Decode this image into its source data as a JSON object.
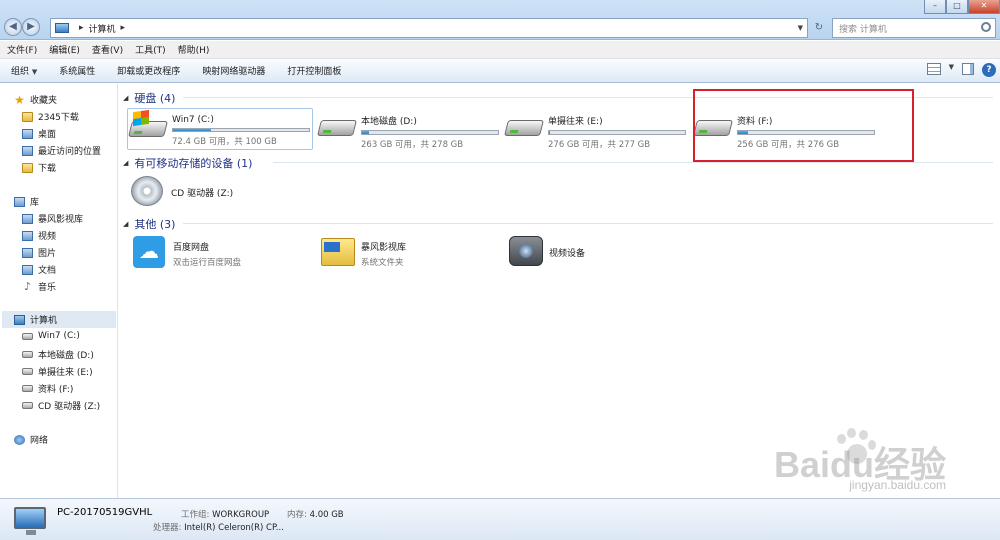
{
  "address": {
    "path": "计算机"
  },
  "search": {
    "placeholder": "搜索 计算机"
  },
  "menu": [
    "文件(F)",
    "编辑(E)",
    "查看(V)",
    "工具(T)",
    "帮助(H)"
  ],
  "commands": [
    "组织",
    "系统属性",
    "卸载或更改程序",
    "映射网络驱动器",
    "打开控制面板"
  ],
  "nav": {
    "favorites": {
      "label": "收藏夹",
      "items": [
        "2345下载",
        "桌面",
        "最近访问的位置",
        "下载"
      ]
    },
    "libraries": {
      "label": "库",
      "items": [
        "暴风影视库",
        "视频",
        "图片",
        "文档",
        "音乐"
      ]
    },
    "computer": {
      "label": "计算机",
      "items": [
        "Win7 (C:)",
        "本地磁盘 (D:)",
        "单摄往来 (E:)",
        "资料 (F:)",
        "CD 驱动器 (Z:)"
      ]
    },
    "network": {
      "label": "网络"
    }
  },
  "groups": {
    "hdd": {
      "title": "硬盘 (4)"
    },
    "removable": {
      "title": "有可移动存储的设备 (1)"
    },
    "other": {
      "title": "其他 (3)"
    }
  },
  "drives": [
    {
      "name": "Win7 (C:)",
      "free": "72.4 GB 可用，共 100 GB",
      "used_fraction": 0.28
    },
    {
      "name": "本地磁盘 (D:)",
      "free": "263 GB 可用，共 278 GB",
      "used_fraction": 0.05
    },
    {
      "name": "单摄往来 (E:)",
      "free": "276 GB 可用，共 277 GB",
      "used_fraction": 0.01
    },
    {
      "name": "资料 (F:)",
      "free": "256 GB 可用，共 276 GB",
      "used_fraction": 0.07
    }
  ],
  "removable": [
    {
      "name": "CD 驱动器 (Z:)"
    }
  ],
  "other": [
    {
      "name": "百度网盘",
      "desc": "双击运行百度网盘"
    },
    {
      "name": "暴风影视库",
      "desc": "系统文件夹"
    },
    {
      "name": "视频设备",
      "desc": ""
    }
  ],
  "details": {
    "pc_name": "PC-20170519GVHL",
    "workgroup_label": "工作组:",
    "workgroup": "WORKGROUP",
    "memory_label": "内存:",
    "memory": "4.00 GB",
    "cpu_label": "处理器:",
    "cpu": "Intel(R) Celeron(R) CP..."
  },
  "watermark": {
    "brand": "Bai",
    "brand2": "du",
    "brand_cn": "经验",
    "url": "jingyan.baidu.com"
  },
  "colors": {
    "accent": "#1e3287",
    "highlight": "#d6202b",
    "bar_fill": "#1c84c6"
  }
}
